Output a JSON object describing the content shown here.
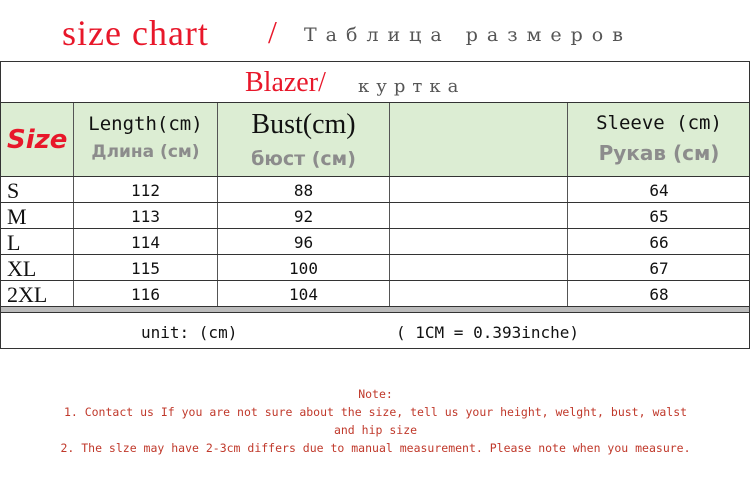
{
  "title": {
    "main": "size chart",
    "slash": "/",
    "ru": "Таблица размеров"
  },
  "product": {
    "en": "Blazer/",
    "ru": "куртка"
  },
  "headers": {
    "size": "Size",
    "length_en": "Length(cm)",
    "length_ru": "Длина (см)",
    "bust_en": "Bust(cm)",
    "bust_ru": "бюст (см)",
    "sleeve_en": "Sleeve (cm)",
    "sleeve_ru": "Рукав (см)"
  },
  "rows": [
    {
      "size": "S",
      "length": "112",
      "bust": "88",
      "sleeve": "64"
    },
    {
      "size": "M",
      "length": "113",
      "bust": "92",
      "sleeve": "65"
    },
    {
      "size": "L",
      "length": "114",
      "bust": "96",
      "sleeve": "66"
    },
    {
      "size": "XL",
      "length": "115",
      "bust": "100",
      "sleeve": "67"
    },
    {
      "size": "2XL",
      "length": "116",
      "bust": "104",
      "sleeve": "68"
    }
  ],
  "unit": {
    "label": "unit: (cm)",
    "conversion": "( 1CM = 0.393inche)"
  },
  "notes": {
    "heading": "Note:",
    "line1a": "1. Contact us If you are not sure about the size, tell us your height, welght, bust, walst",
    "line1b": "and hip size",
    "line2": "2. The slze may have 2-3cm differs due to manual measurement. Please note when you measure."
  },
  "colors": {
    "accent_red": "#e8172a",
    "header_green": "#dcedd3",
    "note_red": "#c0392b"
  }
}
